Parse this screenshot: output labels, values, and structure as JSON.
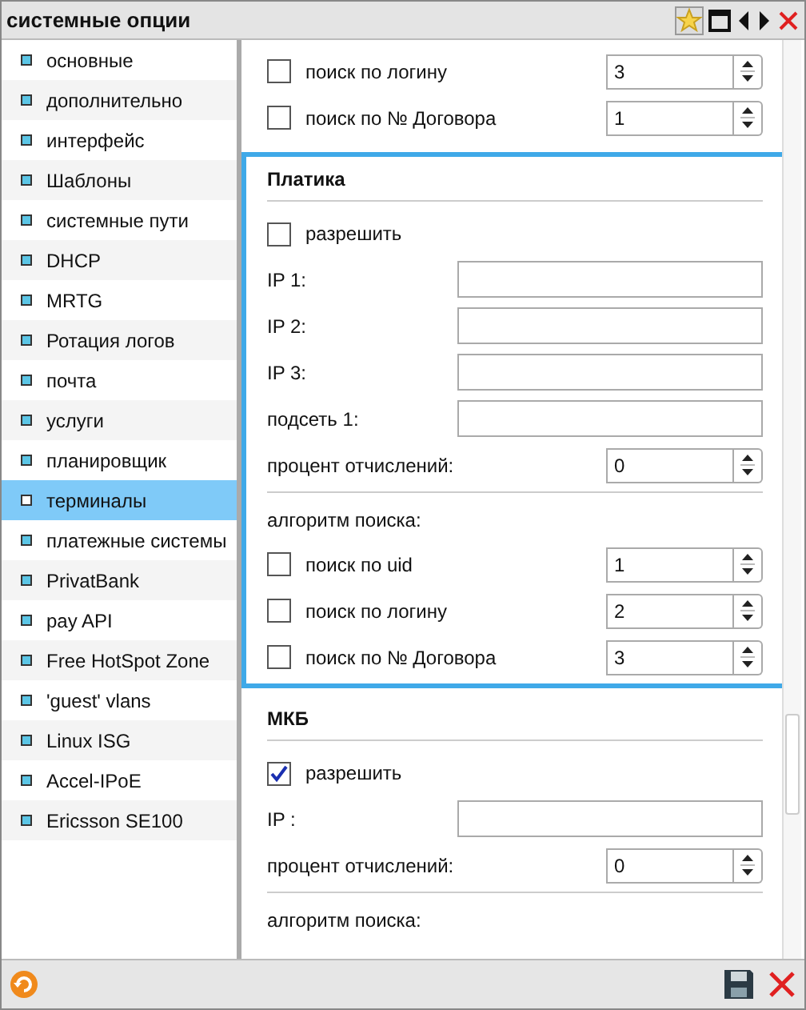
{
  "window": {
    "title": "системные опции"
  },
  "sidebar": {
    "items": [
      {
        "label": "основные",
        "selected": false
      },
      {
        "label": "дополнительно",
        "selected": false
      },
      {
        "label": "интерфейс",
        "selected": false
      },
      {
        "label": "Шаблоны",
        "selected": false
      },
      {
        "label": "системные пути",
        "selected": false
      },
      {
        "label": "DHCP",
        "selected": false
      },
      {
        "label": "MRTG",
        "selected": false
      },
      {
        "label": "Ротация логов",
        "selected": false
      },
      {
        "label": "почта",
        "selected": false
      },
      {
        "label": "услуги",
        "selected": false
      },
      {
        "label": "планировщик",
        "selected": false
      },
      {
        "label": "терминалы",
        "selected": true
      },
      {
        "label": "платежные системы",
        "selected": false
      },
      {
        "label": "PrivatBank",
        "selected": false
      },
      {
        "label": "pay API",
        "selected": false
      },
      {
        "label": "Free HotSpot Zone",
        "selected": false
      },
      {
        "label": "'guest' vlans",
        "selected": false
      },
      {
        "label": "Linux ISG",
        "selected": false
      },
      {
        "label": "Accel-IPoE",
        "selected": false
      },
      {
        "label": "Ericsson SE100",
        "selected": false
      }
    ]
  },
  "sections": [
    {
      "highlighted": false,
      "search_rows": [
        {
          "label": "поиск по логину",
          "checked": false,
          "value": "3"
        },
        {
          "label": "поиск по № Договора",
          "checked": false,
          "value": "1"
        }
      ]
    },
    {
      "highlighted": true,
      "title": "Платика",
      "enable": {
        "label": "разрешить",
        "checked": false
      },
      "fields": [
        {
          "label": "IP 1:"
        },
        {
          "label": "IP 2:"
        },
        {
          "label": "IP 3:"
        },
        {
          "label": "подсеть 1:"
        }
      ],
      "percent": {
        "label": "процент отчислений:",
        "value": "0"
      },
      "search_label": "алгоритм поиска:",
      "search_rows": [
        {
          "label": "поиск по uid",
          "checked": false,
          "value": "1"
        },
        {
          "label": "поиск по логину",
          "checked": false,
          "value": "2"
        },
        {
          "label": "поиск по № Договора",
          "checked": false,
          "value": "3"
        }
      ]
    },
    {
      "highlighted": false,
      "title": "МКБ",
      "enable": {
        "label": "разрешить",
        "checked": true
      },
      "fields": [
        {
          "label": "IP :"
        }
      ],
      "percent": {
        "label": "процент отчислений:",
        "value": "0"
      },
      "search_label": "алгоритм поиска:"
    }
  ]
}
